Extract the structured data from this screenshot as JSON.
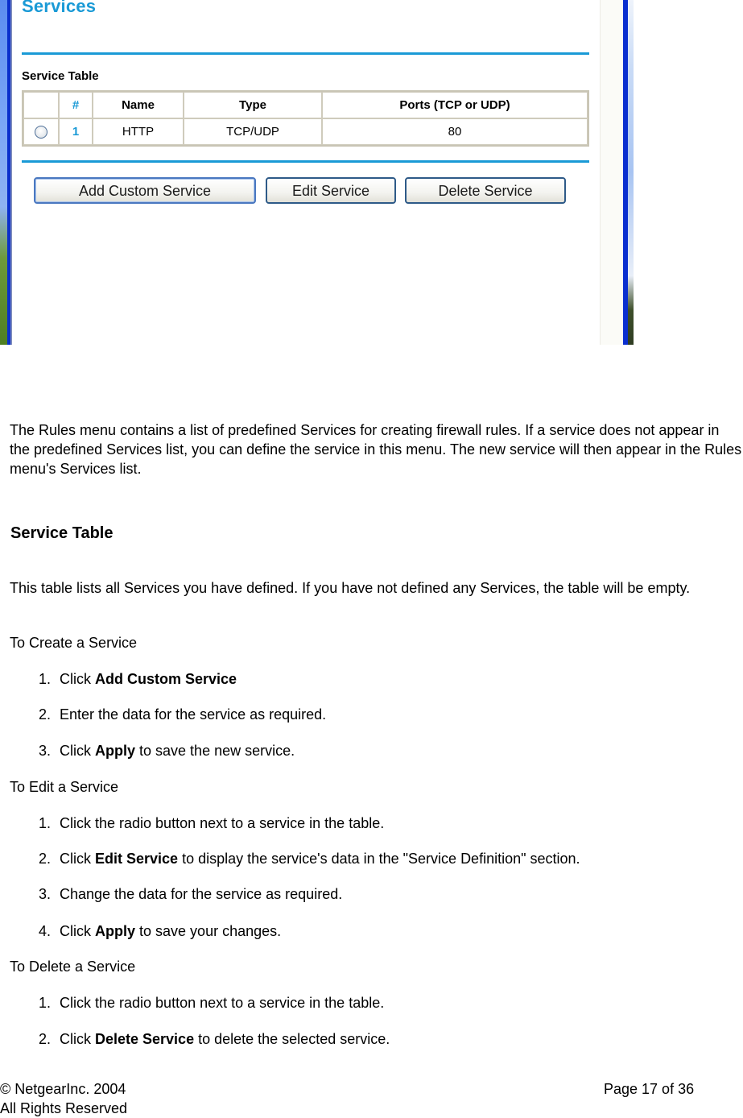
{
  "screenshot": {
    "page_title": "Services",
    "table_caption": "Service Table",
    "columns": [
      "",
      "#",
      "Name",
      "Type",
      "Ports (TCP or UDP)"
    ],
    "rows": [
      {
        "selected": false,
        "num": "1",
        "name": "HTTP",
        "type": "TCP/UDP",
        "ports": "80"
      }
    ],
    "buttons": {
      "add": "Add Custom Service",
      "edit": "Edit Service",
      "delete": "Delete Service"
    },
    "accent_color": "#1a9ad6"
  },
  "document": {
    "intro": "The Rules menu contains a list of predefined Services for creating firewall rules. If a service does not appear in the predefined Services list, you can define the service in this menu. The new service will then appear in the Rules menu's Services list.",
    "section_heading": "Service Table",
    "section_body": "This table lists all Services you have defined. If you have not defined any Services, the table will be empty.",
    "create": {
      "title": "To Create a Service",
      "steps": [
        {
          "num": "1.",
          "pre": "Click ",
          "bold": "Add Custom Service",
          "post": ""
        },
        {
          "num": "2.",
          "pre": "Enter the data for the service as required.",
          "bold": "",
          "post": ""
        },
        {
          "num": "3.",
          "pre": "Click ",
          "bold": "Apply",
          "post": " to save the new service."
        }
      ]
    },
    "edit": {
      "title": "To Edit a Service",
      "steps": [
        {
          "num": "1.",
          "pre": "Click the radio button next to a service in the table.",
          "bold": "",
          "post": ""
        },
        {
          "num": "2.",
          "pre": "Click ",
          "bold": "Edit Service",
          "post": " to display the service's data in the \"Service Definition\" section."
        },
        {
          "num": "3.",
          "pre": "Change the data for the service as required.",
          "bold": "",
          "post": ""
        },
        {
          "num": "4.",
          "pre": "Click ",
          "bold": "Apply",
          "post": " to save your changes."
        }
      ]
    },
    "delete": {
      "title": "To Delete a Service",
      "steps": [
        {
          "num": "1.",
          "pre": "Click the radio button next to a service in the table.",
          "bold": "",
          "post": ""
        },
        {
          "num": "2.",
          "pre": "Click ",
          "bold": "Delete Service",
          "post": " to delete the selected service."
        }
      ]
    }
  },
  "footer": {
    "copyright": "© NetgearInc. 2004",
    "rights": "All Rights Reserved",
    "page": "Page 17 of 36"
  }
}
